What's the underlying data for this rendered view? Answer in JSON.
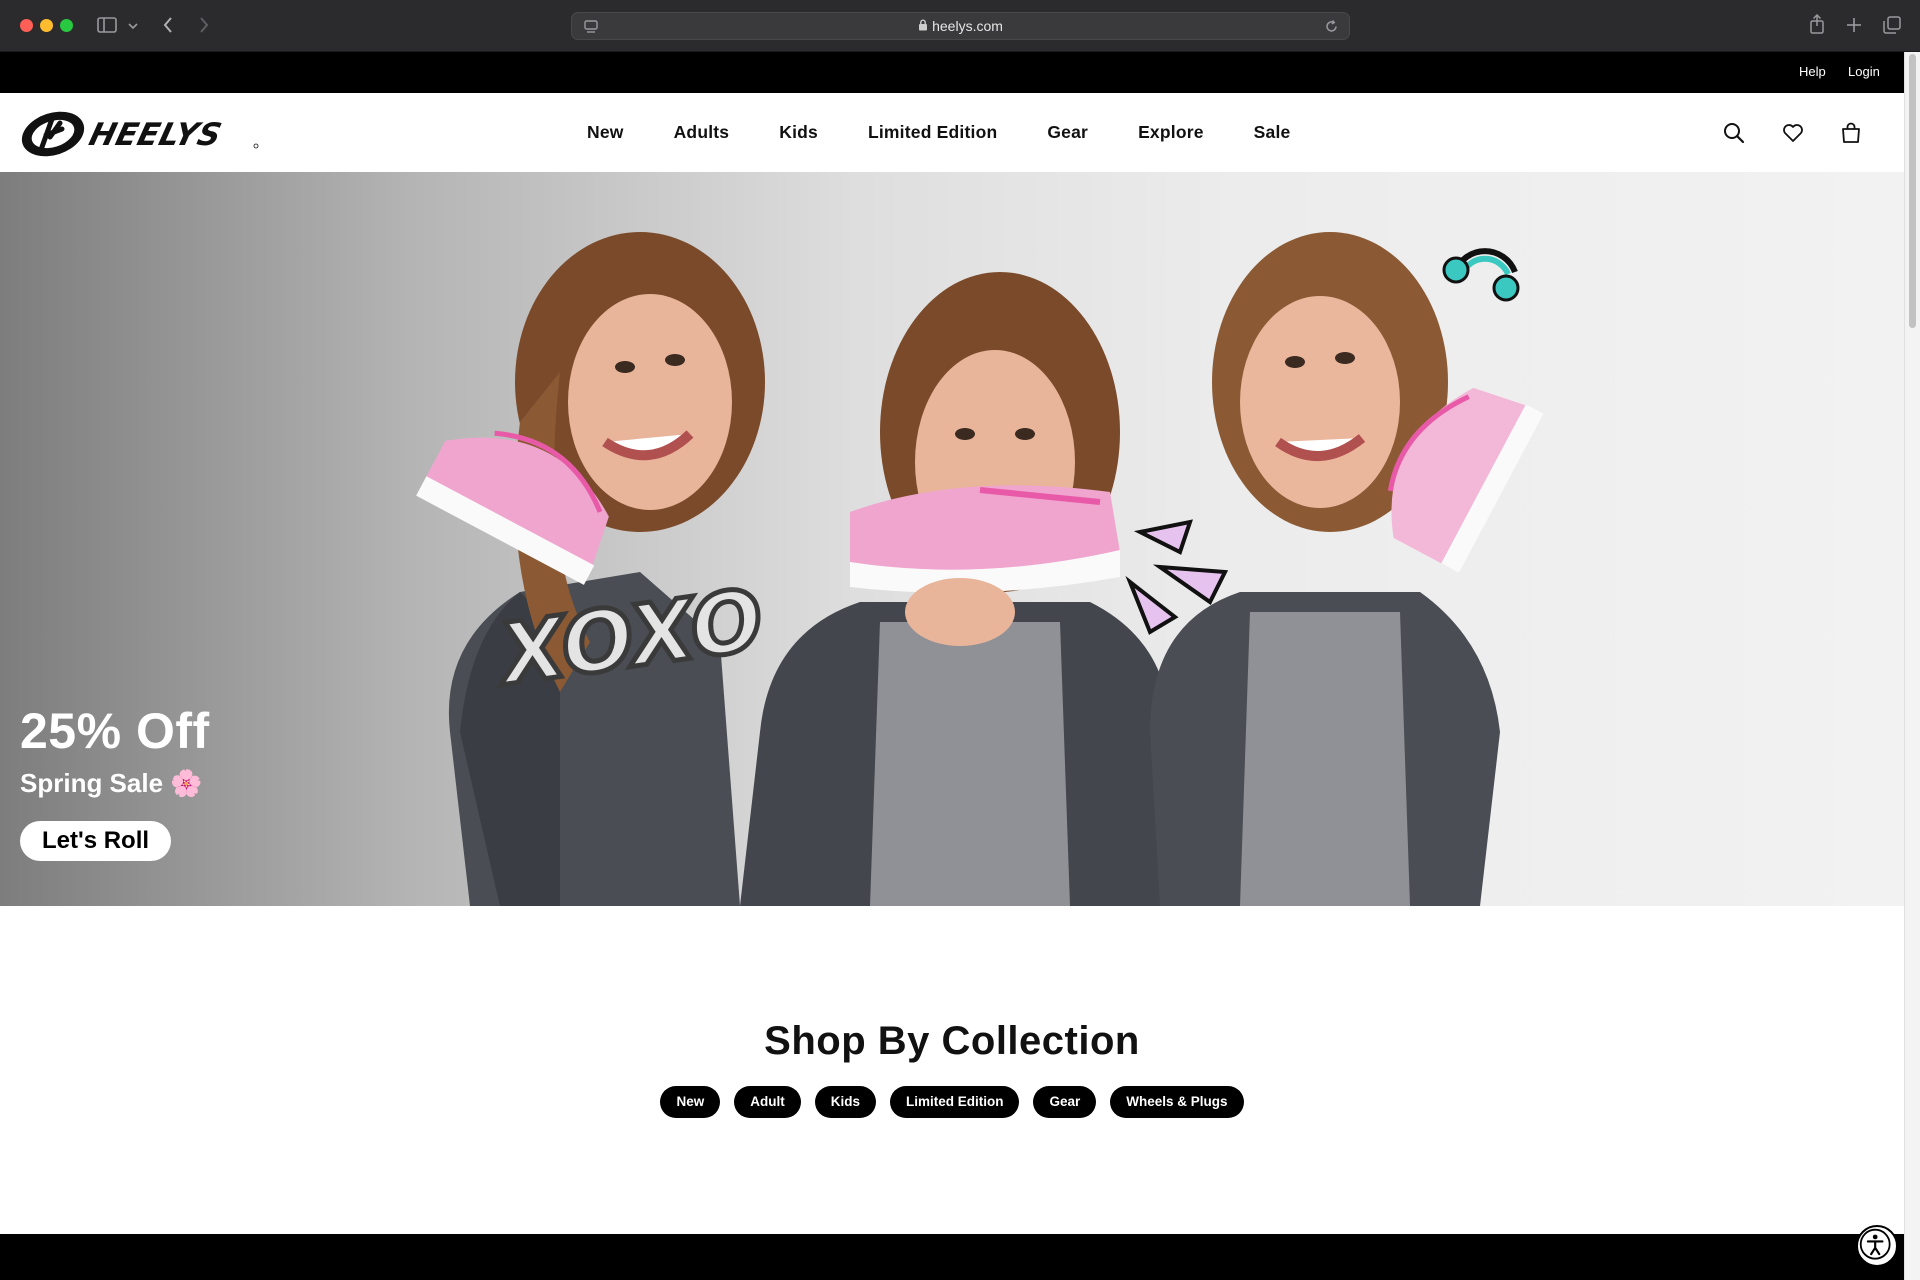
{
  "browser": {
    "url": "heelys.com",
    "icons": [
      "sidebar-icon",
      "chevron-down-icon",
      "back-icon",
      "forward-icon",
      "page-menu-icon",
      "lock-icon",
      "reload-icon",
      "share-icon",
      "new-tab-icon",
      "tabs-overview-icon"
    ]
  },
  "utility": {
    "help": "Help",
    "login": "Login"
  },
  "nav": {
    "logo_text": "HEELYS",
    "items": [
      "New",
      "Adults",
      "Kids",
      "Limited Edition",
      "Gear",
      "Explore",
      "Sale"
    ],
    "icons": [
      "search-icon",
      "heart-icon",
      "bag-icon"
    ]
  },
  "hero": {
    "title": "25% Off",
    "subtitle": "Spring Sale 🌸",
    "cta": "Let's Roll",
    "sticker_text": "XOXO"
  },
  "collection": {
    "heading": "Shop By Collection",
    "pills": [
      "New",
      "Adult",
      "Kids",
      "Limited Edition",
      "Gear",
      "Wheels & Plugs"
    ]
  },
  "colors": {
    "chrome_bg": "#2b2b2d",
    "utility_bg": "#000000",
    "accent_pink": "#e85aa8",
    "sticker_teal": "#3ac8c0"
  }
}
